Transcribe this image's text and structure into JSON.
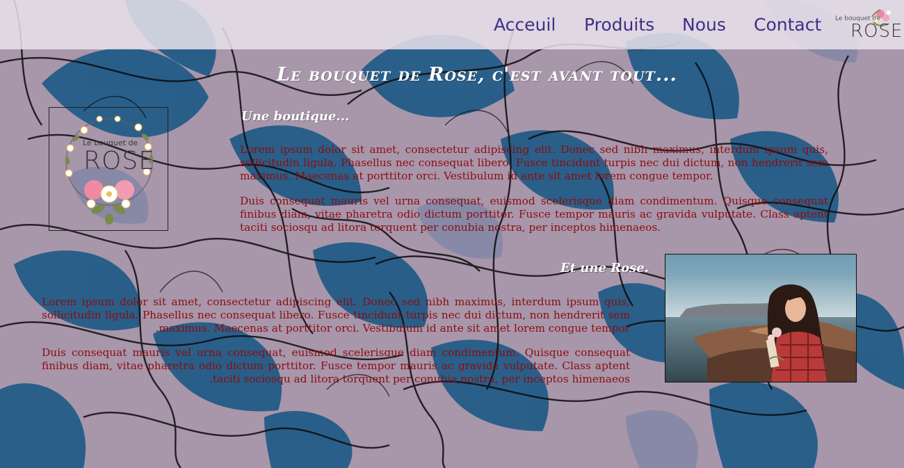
{
  "nav": {
    "links": [
      "Acceuil",
      "Produits",
      "Nous",
      "Contact"
    ],
    "logo": {
      "small": "Le bouquet de",
      "big": "ROSE"
    }
  },
  "main": {
    "title": "Le bouquet de Rose, c'est avant tout...",
    "section1": {
      "title": "Une boutique...",
      "paragraphs": [
        "Lorem ipsum dolor sit amet, consectetur adipiscing elit. Donec sed nibh maximus, interdum ipsum quis, sollicitudin ligula. Phasellus nec consequat libero. Fusce tincidunt turpis nec dui dictum, non hendrerit sem maximus. Maecenas at porttitor orci. Vestibulum id ante sit amet lorem congue tempor.",
        "Duis consequat mauris vel urna consequat, euismod scelerisque diam condimentum. Quisque consequat finibus diam, vitae pharetra odio dictum porttitor. Fusce tempor mauris ac gravida vulputate. Class aptent taciti sociosqu ad litora torquent per conubia nostra, per inceptos himenaeos."
      ]
    },
    "section2": {
      "title": "Et une Rose.",
      "paragraphs": [
        "Lorem ipsum dolor sit amet, consectetur adipiscing elit. Donec sed nibh maximus, interdum ipsum quis, sollicitudin ligula. Phasellus nec consequat libero. Fusce tincidunt turpis nec dui dictum, non hendrerit sem maximus. Maecenas at porttitor orci. Vestibulum id ante sit amet lorem congue tempor.",
        "Duis consequat mauris vel urna consequat, euismod scelerisque diam condimentum. Quisque consequat finibus diam, vitae pharetra odio dictum porttitor. Fusce tempor mauris ac gravida vulputate. Class aptent taciti sociosqu ad litora torquent per conubia nostra, per inceptos himenaeos."
      ]
    }
  },
  "shop_logo": {
    "small": "Le bouquet de",
    "big": "ROSE"
  },
  "icons": [
    "floral-background-pattern",
    "flower-wreath-icon",
    "portrait-photo"
  ],
  "colors": {
    "nav_text": "#3f2f86",
    "paragraph": "#8b0d0d",
    "heading": "#ffffff",
    "background": "#a896ab",
    "petal_blue": "#1f5a86"
  }
}
